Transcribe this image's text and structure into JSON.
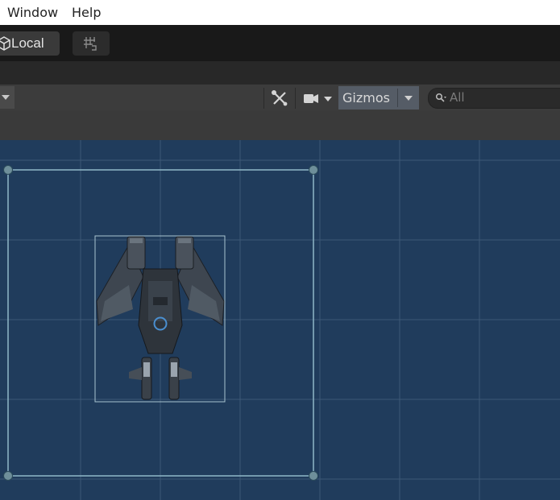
{
  "menu": {
    "items": [
      "Window",
      "Help"
    ]
  },
  "toolbar": {
    "pivot_label": "Local",
    "grid_snap_icon": "grid-snap-icon"
  },
  "scene_toolbar": {
    "tools_icon": "wrench-cross-icon",
    "camera_icon": "video-camera-icon",
    "gizmos_label": "Gizmos",
    "search_placeholder": "All"
  },
  "viewport": {
    "background": "#203c5c",
    "grid_color": "#3f5a78",
    "selection_color": "#8fb8c8"
  }
}
